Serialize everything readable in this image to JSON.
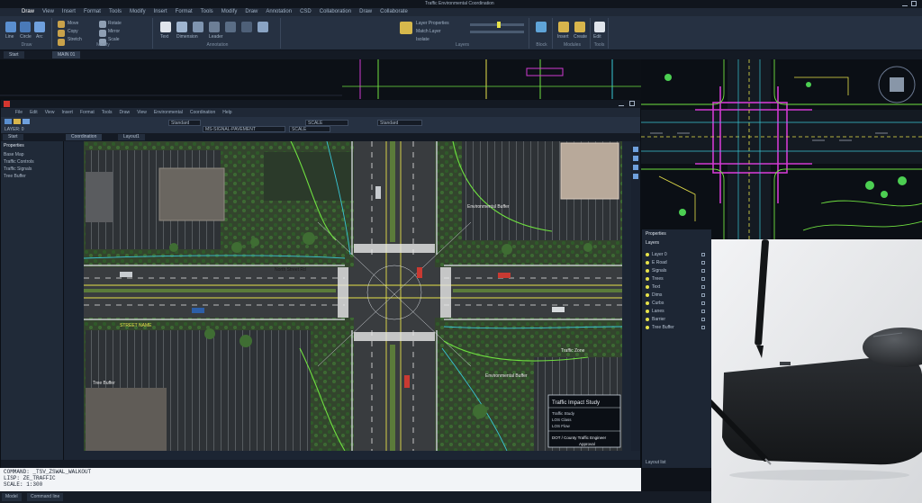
{
  "app": {
    "title": "Traffic Environmental Coordination",
    "back_window_menu": [
      "Draw",
      "View",
      "Insert",
      "Format",
      "Tools",
      "Modify",
      "Insert",
      "Format",
      "Tools",
      "Modify",
      "Draw",
      "Annotation",
      "CSD",
      "Collaboration",
      "Draw",
      "Collaborate"
    ],
    "back_window_menu_active": 0
  },
  "ribbon": {
    "draw_label": "Draw",
    "modify_label": "Modify",
    "annotation_label": "Annotation",
    "layers_label": "Layers",
    "block_label": "Block",
    "modules_label": "Modules",
    "tools_label": "Tools",
    "line_label": "Line",
    "circle_label": "Circle",
    "arc_label": "Arc",
    "move_label": "Move",
    "copy_label": "Copy",
    "stretch_label": "Stretch",
    "rotate_label": "Rotate",
    "mirror_label": "Mirror",
    "scale_label": "Scale",
    "trim_label": "Trim",
    "fillet_label": "Fillet",
    "array_label": "Array",
    "text_label": "Text",
    "dimension_label": "Dimension",
    "leader_label": "Leader",
    "layer_props_label": "Layer Properties",
    "match_layer_label": "Match Layer",
    "isolate_label": "Isolate",
    "insert_label": "Insert",
    "create_label": "Create",
    "edit_label": "Edit"
  },
  "back_tabs": [
    "Start",
    "MAIN 01"
  ],
  "front_window": {
    "menu": [
      "File",
      "Edit",
      "View",
      "Insert",
      "Format",
      "Tools",
      "Draw",
      "View",
      "Environmental",
      "Coordination",
      "Help"
    ],
    "layer_dropdown": "LAYER: 0",
    "layer_dropdown2": "MS-SIGNAL-PAVEMENT",
    "scale_dropdown": "SCALE",
    "style_dropdown": "Standard",
    "tabs": [
      "Start",
      "Coordination",
      "Layout1",
      "Sheet 01"
    ],
    "left_panel_title": "Properties",
    "left_panel_items": [
      "Base Map",
      "Traffic Controls",
      "Traffic Signals",
      "Tree Buffer"
    ]
  },
  "map_labels": {
    "north_street": "North Street Rd",
    "street_label": "STREET NAME",
    "buffer_label": "Environmental Buffer",
    "buffer_label_2": "Environmental Buffer",
    "buffer_top": "Environmental Buffer",
    "zone_label": "Traffic Zone",
    "study_title": "Traffic Impact Study",
    "study_sub1": "Traffic Study",
    "study_sub2": "LOS Class",
    "study_sub3": "LOS Flow",
    "engineer": "DOT / County Traffic Engineer",
    "approval": "Approval",
    "tree_label": "Tree Buffer"
  },
  "layer_panel": {
    "title": "Properties",
    "layers_title": "Layers",
    "rows": [
      "Layer 0",
      "E Road",
      "Signals",
      "Trees",
      "Text",
      "Dims",
      "Curbs",
      "Lanes",
      "Barrier",
      "Tree Buffer"
    ],
    "footer": "Layout list"
  },
  "command_line": {
    "line1": "COMMAND: _TSV_ZSWAL_WALKOUT",
    "line2": "LISP: ZE_TRAFFIC",
    "line3": "SCALE: 1:300",
    "cursor": "_"
  },
  "status_tabs": [
    "Model",
    "Command line"
  ],
  "colors": {
    "canvas_bg": "#0b0f15",
    "road": "#3a3d40",
    "magenta": "#d13ad1",
    "lime": "#6fe040",
    "cyan": "#38c7d6",
    "yellow": "#e7e24a",
    "desk": "#e9eaed"
  }
}
